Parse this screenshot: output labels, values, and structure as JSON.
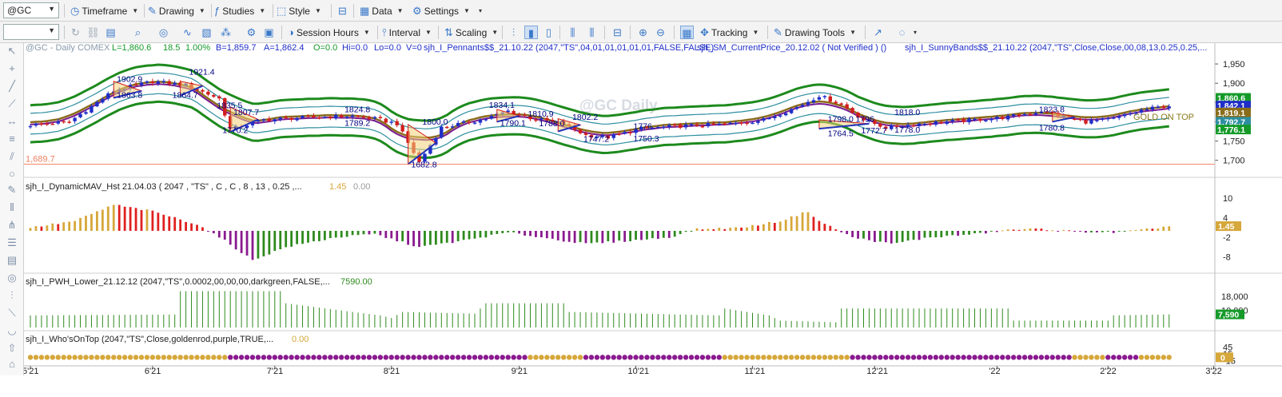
{
  "toolbar1": {
    "symbol": "@GC",
    "timeframe": "Timeframe",
    "drawing": "Drawing",
    "studies": "Studies",
    "style": "Style",
    "data": "Data",
    "settings": "Settings"
  },
  "toolbar2": {
    "session_hours": "Session Hours",
    "interval": "Interval",
    "scaling": "Scaling",
    "tracking": "Tracking",
    "drawing_tools": "Drawing Tools"
  },
  "price_pane": {
    "header": {
      "symbol": "@GC - Daily  COMEX",
      "last": "L=1,860.6",
      "change": "18.5",
      "pct": "1.00%",
      "bid": "B=1,859.7",
      "ask": "A=1,862.4",
      "open": "O=0.0",
      "hi": "Hi=0.0",
      "lo": "Lo=0.0",
      "vol": "V=0",
      "study1": "sjh_I_Pennants$$_21.10.22 (2047,\"TS\",04,01,01,01,01,01,FALSE,FALSE)",
      "study2": "sjh_SM_CurrentPrice_20.12.02 ( Not Verified ) ()",
      "study3": "sjh_I_SunnyBands$$_21.10.22 (2047,\"TS\",Close,Close,00,08,13,0.25,0.25,..."
    },
    "watermark": "@GC Daily",
    "gold_on_top": "GOLD ON TOP",
    "hline_value": 1689.7,
    "hline_label": "1,689.7",
    "annotations": [
      {
        "text": "1921.4",
        "i": 30,
        "p": 1922,
        "color": "#000080"
      },
      {
        "text": "1902.9",
        "i": 17,
        "p": 1904,
        "color": "#000080"
      },
      {
        "text": "1863.8",
        "i": 17,
        "p": 1862,
        "color": "#000080"
      },
      {
        "text": "1864.7",
        "i": 27,
        "p": 1862,
        "color": "#000080"
      },
      {
        "text": "1835.5",
        "i": 35,
        "p": 1835,
        "color": "#000080"
      },
      {
        "text": "1807.7",
        "i": 38,
        "p": 1818,
        "color": "#000080"
      },
      {
        "text": "1770.2",
        "i": 36,
        "p": 1771,
        "color": "#000080"
      },
      {
        "text": "1824.8",
        "i": 58,
        "p": 1825,
        "color": "#000080"
      },
      {
        "text": "1789.2",
        "i": 58,
        "p": 1790,
        "color": "#000080"
      },
      {
        "text": "1682.8",
        "i": 70,
        "p": 1682,
        "color": "#000080"
      },
      {
        "text": "1800.0",
        "i": 72,
        "p": 1793,
        "color": "#000080"
      },
      {
        "text": "1834.1",
        "i": 84,
        "p": 1836,
        "color": "#000080"
      },
      {
        "text": "1810.9",
        "i": 91,
        "p": 1813,
        "color": "#000080"
      },
      {
        "text": "1802.2",
        "i": 99,
        "p": 1805,
        "color": "#000080"
      },
      {
        "text": "1790.1",
        "i": 86,
        "p": 1790,
        "color": "#000080"
      },
      {
        "text": "1788.0",
        "i": 93,
        "p": 1789,
        "color": "#000080"
      },
      {
        "text": "1776",
        "i": 110,
        "p": 1781,
        "color": "#000080"
      },
      {
        "text": "1747.2",
        "i": 101,
        "p": 1748,
        "color": "#000080"
      },
      {
        "text": "1750.3",
        "i": 110,
        "p": 1749,
        "color": "#000080"
      },
      {
        "text": "1798.0",
        "i": 145,
        "p": 1800,
        "color": "#000080"
      },
      {
        "text": "1796",
        "i": 150,
        "p": 1800,
        "color": "#000080"
      },
      {
        "text": "1818.0",
        "i": 157,
        "p": 1818,
        "color": "#000080"
      },
      {
        "text": "1764.5",
        "i": 145,
        "p": 1763,
        "color": "#000080"
      },
      {
        "text": "1772.7",
        "i": 151,
        "p": 1770,
        "color": "#000080"
      },
      {
        "text": "1778.0",
        "i": 157,
        "p": 1772,
        "color": "#000080"
      },
      {
        "text": "1823.8",
        "i": 183,
        "p": 1825,
        "color": "#000080"
      },
      {
        "text": "1780.8",
        "i": 183,
        "p": 1777,
        "color": "#000080"
      }
    ],
    "axis_ticks": [
      "1,950",
      "1,900",
      "1,850",
      "1,800",
      "1,750",
      "1,700"
    ],
    "axis_tick_values": [
      1950,
      1900,
      1850,
      1800,
      1750,
      1700
    ],
    "flags": [
      {
        "text": "1,860.6",
        "v": 1862,
        "color": "#159a2a"
      },
      {
        "text": "1,842.1",
        "v": 1842,
        "color": "#1f2ec8"
      },
      {
        "text": "1,819.1",
        "v": 1824,
        "color": "#8a6d1a"
      },
      {
        "text": "1,792.7",
        "v": 1800,
        "color": "#2e8fa0"
      },
      {
        "text": "1,776.1",
        "v": 1780,
        "color": "#159a2a"
      }
    ]
  },
  "mav_pane": {
    "title": "sjh_I_DynamicMAV_Hst 21.04.03 ( 2047 , \"TS\" , C , C ,  8 , 13 , 0.25 ,...",
    "v1": "1.45",
    "v2": "0.00",
    "axis_ticks": [
      "10",
      "4",
      "-2",
      "-8"
    ],
    "axis_tick_values": [
      10,
      4,
      -2,
      -8
    ],
    "flag": "1.45"
  },
  "pwh_pane": {
    "title": "sjh_I_PWH_Lower_21.12.12 (2047,\"TS\",0.0002,00,00,00,darkgreen,FALSE,...",
    "value": "7590.00",
    "axis_ticks": [
      "18,000",
      "10,000"
    ],
    "axis_tick_values": [
      18000,
      10000
    ],
    "flag": "7,590"
  },
  "who_pane": {
    "title": "sjh_I_Who'sOnTop (2047,\"TS\",Close,goldenrod,purple,TRUE,...",
    "value": "0.00",
    "axis_ticks": [
      "45",
      "15",
      "-15"
    ],
    "axis_tick_values": [
      45,
      15,
      -15
    ],
    "flag": "0"
  },
  "time_axis": {
    "labels": [
      {
        "text": "5'21",
        "i": 0
      },
      {
        "text": "6'21",
        "i": 22
      },
      {
        "text": "7'21",
        "i": 44
      },
      {
        "text": "8'21",
        "i": 65
      },
      {
        "text": "9'21",
        "i": 88
      },
      {
        "text": "10'21",
        "i": 109
      },
      {
        "text": "11'21",
        "i": 130
      },
      {
        "text": "12'21",
        "i": 152
      },
      {
        "text": "'22",
        "i": 174
      },
      {
        "text": "2'22",
        "i": 194
      },
      {
        "text": "3'22",
        "i": 213
      }
    ]
  },
  "chart_data": {
    "type": "candlestick",
    "bars": 206,
    "price_keypoints": [
      [
        0,
        1792
      ],
      [
        7,
        1800
      ],
      [
        15,
        1880
      ],
      [
        22,
        1905
      ],
      [
        28,
        1895
      ],
      [
        34,
        1860
      ],
      [
        36,
        1780
      ],
      [
        42,
        1805
      ],
      [
        48,
        1810
      ],
      [
        58,
        1815
      ],
      [
        62,
        1808
      ],
      [
        66,
        1795
      ],
      [
        70,
        1695
      ],
      [
        74,
        1785
      ],
      [
        82,
        1808
      ],
      [
        86,
        1828
      ],
      [
        90,
        1810
      ],
      [
        96,
        1795
      ],
      [
        100,
        1765
      ],
      [
        104,
        1760
      ],
      [
        110,
        1782
      ],
      [
        118,
        1790
      ],
      [
        125,
        1793
      ],
      [
        132,
        1805
      ],
      [
        138,
        1838
      ],
      [
        142,
        1868
      ],
      [
        146,
        1845
      ],
      [
        150,
        1805
      ],
      [
        154,
        1785
      ],
      [
        160,
        1795
      ],
      [
        168,
        1803
      ],
      [
        176,
        1812
      ],
      [
        182,
        1828
      ],
      [
        186,
        1812
      ],
      [
        190,
        1800
      ],
      [
        195,
        1808
      ],
      [
        200,
        1830
      ],
      [
        205,
        1842
      ]
    ],
    "mav_keypoints": [
      [
        0,
        1
      ],
      [
        8,
        3
      ],
      [
        15,
        8
      ],
      [
        22,
        6
      ],
      [
        30,
        2
      ],
      [
        35,
        -3
      ],
      [
        40,
        -9
      ],
      [
        46,
        -5
      ],
      [
        55,
        -2
      ],
      [
        62,
        -1
      ],
      [
        70,
        -5
      ],
      [
        78,
        -3
      ],
      [
        86,
        -0.5
      ],
      [
        92,
        -2
      ],
      [
        100,
        -4
      ],
      [
        108,
        -3
      ],
      [
        115,
        -2
      ],
      [
        120,
        0.5
      ],
      [
        128,
        1
      ],
      [
        135,
        3
      ],
      [
        140,
        6
      ],
      [
        142,
        3
      ],
      [
        148,
        -2
      ],
      [
        155,
        -4
      ],
      [
        162,
        -2
      ],
      [
        170,
        -1
      ],
      [
        176,
        0.3
      ],
      [
        182,
        0.6
      ],
      [
        188,
        -0.2
      ],
      [
        195,
        -0.5
      ],
      [
        200,
        0.2
      ],
      [
        205,
        1.45
      ]
    ],
    "pwh_keypoints": [
      [
        0,
        7000
      ],
      [
        26,
        7500
      ],
      [
        27,
        21000
      ],
      [
        45,
        21000
      ],
      [
        46,
        14000
      ],
      [
        58,
        9000
      ],
      [
        63,
        7000
      ],
      [
        65,
        5500
      ],
      [
        67,
        9000
      ],
      [
        80,
        8000
      ],
      [
        82,
        14000
      ],
      [
        96,
        14000
      ],
      [
        97,
        9000
      ],
      [
        124,
        7000
      ],
      [
        125,
        11000
      ],
      [
        133,
        7000
      ],
      [
        135,
        4000
      ],
      [
        145,
        3000
      ],
      [
        146,
        11000
      ],
      [
        176,
        11000
      ],
      [
        177,
        4000
      ],
      [
        194,
        4000
      ],
      [
        195,
        7000
      ],
      [
        205,
        7590
      ]
    ],
    "who_segments": [
      {
        "from": 0,
        "to": 36,
        "color": "#d6a73a"
      },
      {
        "from": 36,
        "to": 90,
        "color": "#8a1a8f"
      },
      {
        "from": 90,
        "to": 100,
        "color": "#d6a73a"
      },
      {
        "from": 100,
        "to": 125,
        "color": "#8a1a8f"
      },
      {
        "from": 125,
        "to": 148,
        "color": "#d6a73a"
      },
      {
        "from": 148,
        "to": 188,
        "color": "#8a1a8f"
      },
      {
        "from": 188,
        "to": 194,
        "color": "#d6a73a"
      },
      {
        "from": 194,
        "to": 200,
        "color": "#8a1a8f"
      },
      {
        "from": 200,
        "to": 206,
        "color": "#d6a73a"
      }
    ],
    "ylim_price": [
      1660,
      1975
    ],
    "ylim_mav": [
      -12,
      12
    ],
    "ylim_pwh": [
      0,
      24000
    ],
    "ylim_who": [
      -30,
      60
    ],
    "colors": {
      "up": "#1f2ec8",
      "down": "#d21e1e",
      "band_outer": "#1d8a1d",
      "band_inner": "#2e8fa0",
      "mid": "#8a6d1a",
      "pennant": "#7a1a8f",
      "hist_gold": "#d6a73a",
      "hist_red": "#e02020",
      "hist_green": "#2e8a1d",
      "hist_purple": "#8a1a8f",
      "pwh": "#2e8a1d",
      "hline": "#f08060"
    }
  }
}
